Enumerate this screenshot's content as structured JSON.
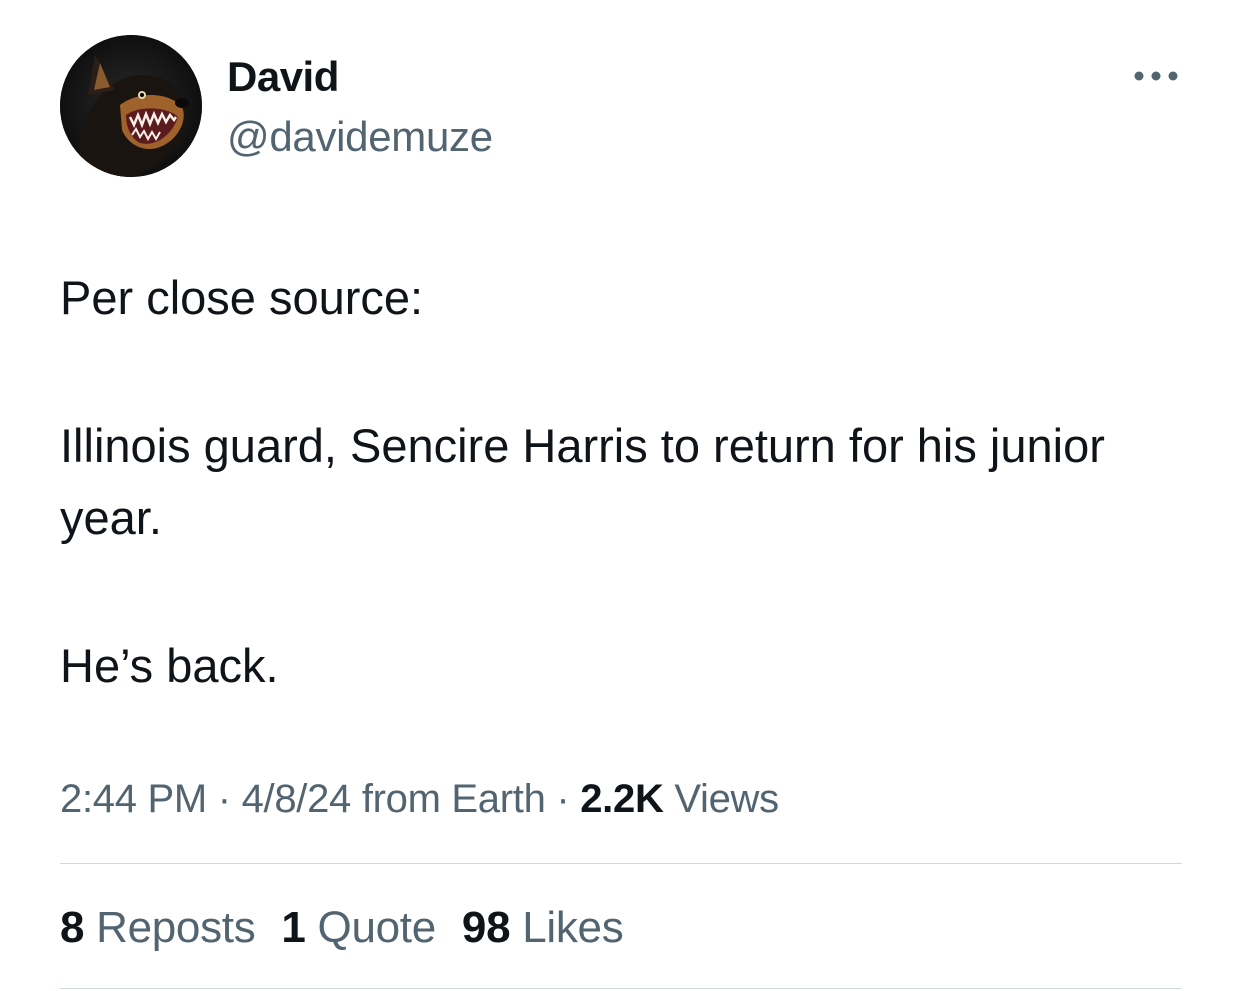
{
  "author": {
    "display_name": "David",
    "handle": "@davidemuze",
    "avatar": "snarling-dog-avatar"
  },
  "menu": {
    "icon": "more-horizontal-icon"
  },
  "tweet": {
    "paragraphs": [
      "Per close source:",
      "Illinois guard, Sencire Harris to return for his junior year.",
      "He’s back."
    ]
  },
  "meta": {
    "time": "2:44 PM",
    "separator": "·",
    "date": "4/8/24",
    "source": "from Earth",
    "views_count": "2.2K",
    "views_label": "Views"
  },
  "stats": {
    "reposts": {
      "count": "8",
      "label": "Reposts"
    },
    "quotes": {
      "count": "1",
      "label": "Quote"
    },
    "likes": {
      "count": "98",
      "label": "Likes"
    }
  },
  "colors": {
    "text_primary": "#0f1419",
    "text_secondary": "#536471",
    "divider": "#cfd9de",
    "background": "#ffffff"
  }
}
